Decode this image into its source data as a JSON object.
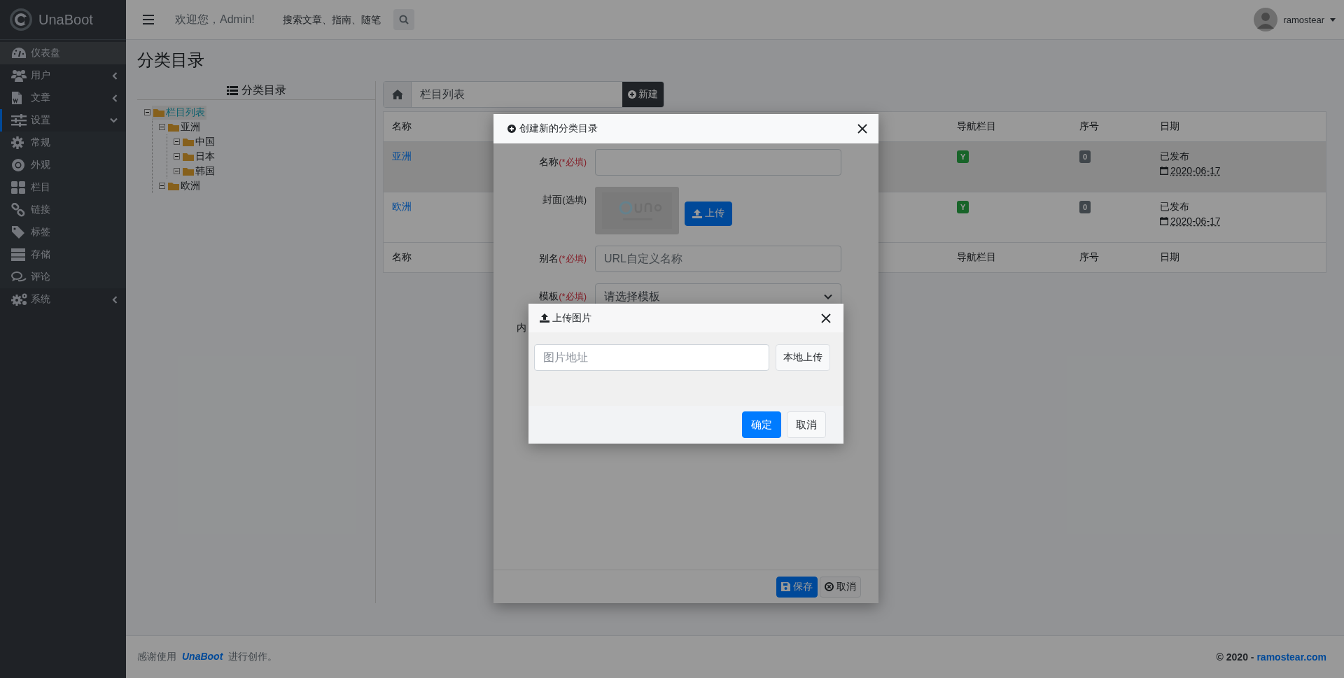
{
  "brand": {
    "name": "UnaBoot"
  },
  "header": {
    "welcome": "欢迎您，Admin!",
    "search": {
      "placeholder": "搜索文章、指南、随笔"
    },
    "user": {
      "name": "ramostear"
    }
  },
  "sidebar": {
    "items": [
      {
        "label": "仪表盘",
        "selected": true
      },
      {
        "label": "用户",
        "selected": false,
        "expanded": false
      },
      {
        "label": "文章",
        "selected": false,
        "expanded": false
      },
      {
        "label": "设置",
        "selected": false,
        "expanded": true,
        "children": [
          {
            "label": "常规",
            "selected": false
          },
          {
            "label": "外观",
            "selected": false
          },
          {
            "label": "栏目",
            "selected": false
          },
          {
            "label": "链接",
            "selected": false
          },
          {
            "label": "标签",
            "selected": false
          },
          {
            "label": "存储",
            "selected": false
          },
          {
            "label": "评论",
            "selected": false
          }
        ]
      },
      {
        "label": "系统",
        "selected": false,
        "expanded": false
      }
    ]
  },
  "page": {
    "title": "分类目录"
  },
  "tree": {
    "title": "分类目录",
    "nodes": [
      {
        "label": "栏目列表",
        "selected": true,
        "expanded": true,
        "children": [
          {
            "label": "亚洲",
            "selected": false,
            "expanded": true,
            "children": [
              {
                "label": "中国",
                "selected": false,
                "expanded": true
              },
              {
                "label": "日本",
                "selected": false,
                "expanded": true
              },
              {
                "label": "韩国",
                "selected": false,
                "expanded": true
              }
            ]
          },
          {
            "label": "欧洲",
            "selected": false,
            "expanded": true
          }
        ]
      }
    ]
  },
  "list": {
    "breadcrumb": "栏目列表",
    "new_button": "新建",
    "columns": [
      "名称",
      "导航栏目",
      "序号",
      "日期"
    ],
    "rows": [
      {
        "name": "亚洲",
        "nav": "Y",
        "order": "0",
        "status": "已发布",
        "date": "2020-06-17",
        "highlighted": true
      },
      {
        "name": "欧洲",
        "nav": "Y",
        "order": "0",
        "status": "已发布",
        "date": "2020-06-17",
        "highlighted": false
      }
    ],
    "footer_columns": [
      "名称",
      "导航栏目",
      "序号",
      "日期"
    ]
  },
  "create_modal": {
    "title": "创建新的分类目录",
    "fields": [
      {
        "kind": "input",
        "label": "名称",
        "note": "(*必填)",
        "required": true
      },
      {
        "label": "封面",
        "note": "(选填)",
        "required": false,
        "button": "上传"
      },
      {
        "kind": "input",
        "label": "别名",
        "note": "(*必填)",
        "required": true,
        "placeholder": "URL自定义名称"
      },
      {
        "kind": "select",
        "label": "模板",
        "note": "(*必填)",
        "required": true,
        "value": "请选择模板"
      },
      {
        "kind": "cut",
        "label": "内"
      }
    ],
    "buttons": [
      {
        "label": "保存",
        "kind": "primary"
      },
      {
        "label": "取消",
        "kind": "secondary"
      }
    ]
  },
  "upload_modal": {
    "title": "上传图片",
    "field": {
      "placeholder": "图片地址"
    },
    "local_button": "本地上传",
    "buttons": [
      {
        "label": "确定",
        "kind": "primary"
      },
      {
        "label": "取消",
        "kind": "secondary"
      }
    ]
  },
  "footer": {
    "before": "感谢使用",
    "brand": "UnaBoot",
    "after": "进行创作。",
    "copyright": "© 2020 - ",
    "site": "ramostear.com"
  }
}
